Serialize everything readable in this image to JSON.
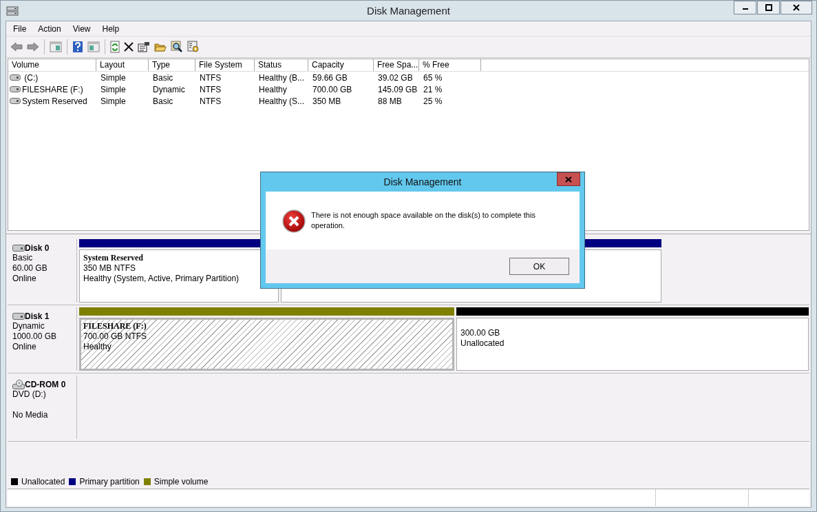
{
  "window": {
    "title": "Disk Management"
  },
  "menu": [
    "File",
    "Action",
    "View",
    "Help"
  ],
  "toolbar": [
    {
      "kind": "back"
    },
    {
      "kind": "forward"
    },
    {
      "kind": "sep"
    },
    {
      "kind": "tree"
    },
    {
      "kind": "sep"
    },
    {
      "kind": "help"
    },
    {
      "kind": "pane"
    },
    {
      "kind": "sep"
    },
    {
      "kind": "refresh"
    },
    {
      "kind": "delete"
    },
    {
      "kind": "properties"
    },
    {
      "kind": "open"
    },
    {
      "kind": "search"
    },
    {
      "kind": "settings"
    }
  ],
  "volumes": {
    "columns": [
      "Volume",
      "Layout",
      "Type",
      "File System",
      "Status",
      "Capacity",
      "Free Spa...",
      "% Free"
    ],
    "rows": [
      {
        "cells": [
          " (C:)",
          "Simple",
          "Basic",
          "NTFS",
          "Healthy (B...",
          "59.66 GB",
          "39.02 GB",
          "65 %"
        ]
      },
      {
        "cells": [
          "FILESHARE (F:)",
          "Simple",
          "Dynamic",
          "NTFS",
          "Healthy",
          "700.00 GB",
          "145.09 GB",
          "21 %"
        ]
      },
      {
        "cells": [
          "System Reserved",
          "Simple",
          "Basic",
          "NTFS",
          "Healthy (S...",
          "350 MB",
          "88 MB",
          "25 %"
        ]
      }
    ]
  },
  "disks": [
    {
      "kind": "disk",
      "name": "Disk 0",
      "type": "Basic",
      "size": "60.00 GB",
      "status": "Online",
      "partitions": [
        {
          "color": "#000080",
          "selected": false,
          "name": "System Reserved",
          "lines": [
            "350 MB NTFS",
            "Healthy (System, Active, Primary Partition)"
          ]
        },
        {
          "color": "#000080",
          "selected": false
        }
      ]
    },
    {
      "kind": "disk",
      "name": "Disk 1",
      "type": "Dynamic",
      "size": "1000.00 GB",
      "status": "Online",
      "partitions": [
        {
          "color": "#808000",
          "selected": true,
          "name": "FILESHARE  (F:)",
          "lines": [
            "700.00 GB NTFS",
            "Healthy"
          ]
        },
        {
          "color": "#000000",
          "selected": false,
          "lines": [
            "300.00 GB",
            "Unallocated"
          ]
        }
      ]
    },
    {
      "kind": "cdrom",
      "name": "CD-ROM 0",
      "type": "DVD (D:)",
      "status": "No Media"
    }
  ],
  "legend": [
    {
      "color": "#000000",
      "label": "Unallocated"
    },
    {
      "color": "#000080",
      "label": "Primary partition"
    },
    {
      "color": "#808000",
      "label": "Simple volume"
    }
  ],
  "dialog": {
    "title": "Disk Management",
    "message": "There is not enough space available on the disk(s) to complete this operation.",
    "button": "OK"
  }
}
